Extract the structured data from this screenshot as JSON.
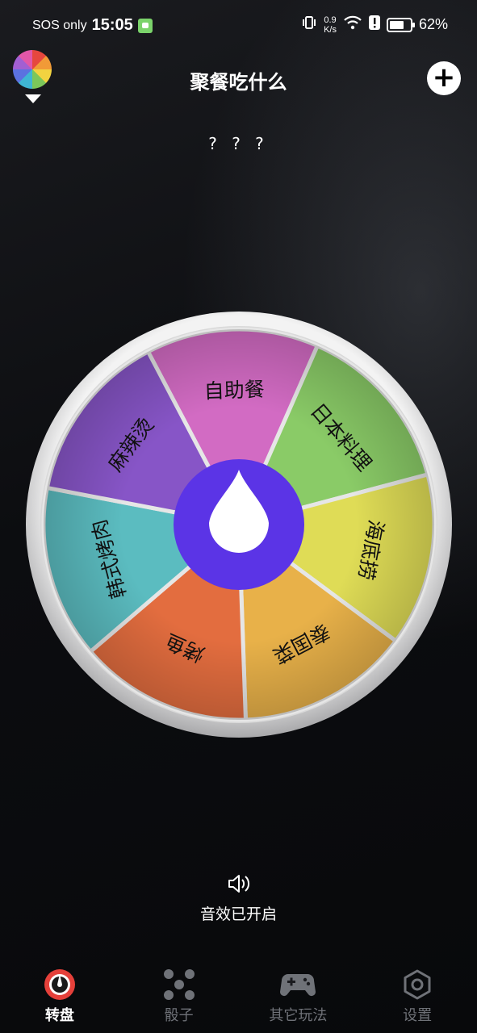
{
  "status_bar": {
    "carrier": "SOS only",
    "time": "15:05",
    "net_speed_value": "0.9",
    "net_speed_unit": "K/s",
    "battery": "62%"
  },
  "header": {
    "title": "聚餐吃什么"
  },
  "result": "? ? ?",
  "wheel": {
    "segments": [
      {
        "label": "自助餐",
        "color": "#d26bc3"
      },
      {
        "label": "日本料理",
        "color": "#8acb67"
      },
      {
        "label": "海底捞",
        "color": "#dfdc56"
      },
      {
        "label": "泰国菜",
        "color": "#e8b149"
      },
      {
        "label": "烤鱼",
        "color": "#e36d3f"
      },
      {
        "label": "韩式烤肉",
        "color": "#5bbcc0"
      },
      {
        "label": "麻辣烫",
        "color": "#8755c7"
      }
    ],
    "hub_color": "#5b34e6"
  },
  "sound": {
    "label": "音效已开启"
  },
  "nav": {
    "items": [
      {
        "label": "转盘"
      },
      {
        "label": "骰子"
      },
      {
        "label": "其它玩法"
      },
      {
        "label": "设置"
      }
    ]
  }
}
